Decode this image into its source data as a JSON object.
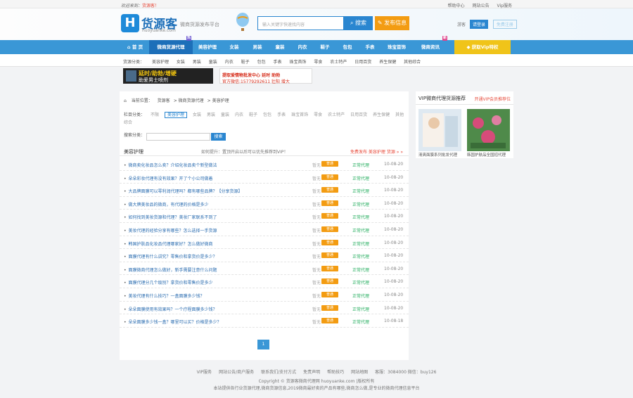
{
  "topbar": {
    "welcome": "欢迎来到：",
    "site": "货源客！",
    "links": [
      "帮助中心",
      "网站公告",
      "Vip服务"
    ]
  },
  "header": {
    "logo_mark": "H",
    "logo_text": "货源客",
    "logo_sub": "huoyuanke.com",
    "slogan": "微商货源发布平台",
    "search_placeholder": "输入关键字快速找内容",
    "search_btn": "搜索",
    "publish_btn": "发布信息",
    "login_hint": "游客",
    "login_btn": "请登录",
    "register_btn": "免费注册"
  },
  "nav": [
    {
      "label": "首 页"
    },
    {
      "label": "微商货源代理",
      "active": true,
      "badge": "热"
    },
    {
      "label": "美容护理"
    },
    {
      "label": "女装"
    },
    {
      "label": "男装"
    },
    {
      "label": "童装"
    },
    {
      "label": "内衣"
    },
    {
      "label": "鞋子"
    },
    {
      "label": "包包"
    },
    {
      "label": "手表"
    },
    {
      "label": "珠宝首饰"
    },
    {
      "label": "微商资讯",
      "badge": "新"
    },
    {
      "label": "获取Vip特权",
      "vip": true
    }
  ],
  "subnav": {
    "label": "货源分类：",
    "items": [
      "美容护理",
      "女装",
      "男装",
      "童装",
      "内衣",
      "鞋子",
      "包包",
      "手表",
      "珠宝首饰",
      "零食",
      "农土特产",
      "日用百货",
      "养生保健",
      "其他综合"
    ]
  },
  "banner1": {
    "a": "延时/助勃/增硬",
    "b": "助爱男士喷剂"
  },
  "banner2": {
    "a": "提取爱情物批发中心 延时 助勃",
    "b": "官方微信:15779292611 壮阳 增大"
  },
  "crumb": [
    "当前位置：",
    "货源客",
    "微商货源代理",
    "美容护理"
  ],
  "filter": {
    "label": "栏目分类：",
    "items": [
      "不限",
      "美容护理",
      "女装",
      "男装",
      "童装",
      "内衣",
      "鞋子",
      "包包",
      "手表",
      "珠宝首饰",
      "零食",
      "农土特产",
      "日用百货",
      "养生保健",
      "其他综合"
    ],
    "selected": 1
  },
  "search": {
    "label": "搜索分类：",
    "btn": "搜索"
  },
  "list": {
    "title": "美容护理",
    "notice": "如何提升：置顶开启以后可以优先推荐到VIP！",
    "action": "免费发布 美容护理 货源 » »"
  },
  "rows": [
    {
      "title": "微商卖化妆品怎么卖？介绍化妆品卖个新型做法",
      "mk": "暂无",
      "tag": "普通",
      "status": "正常代理",
      "date": "10-08-20"
    },
    {
      "title": "朵朵彩妆代理有没有效果？开了个小公司做着",
      "mk": "暂无",
      "tag": "普通",
      "status": "正常代理",
      "date": "10-08-20"
    },
    {
      "title": "大品牌面膜可以零利润代理吗？都有哪些品牌？【分享货源】",
      "mk": "暂无",
      "tag": "普通",
      "status": "正常代理",
      "date": "10-08-20"
    },
    {
      "title": "做大牌美妆品的微商，有代理的价格是多少",
      "mk": "暂无",
      "tag": "普通",
      "status": "正常代理",
      "date": "10-08-20"
    },
    {
      "title": "如何找到美妆货源和代理？美妆厂家联系不到了",
      "mk": "暂无",
      "tag": "普通",
      "status": "正常代理",
      "date": "10-08-20"
    },
    {
      "title": "美妆代理的经验分享有哪些？怎么选择一手货源",
      "mk": "暂无",
      "tag": "普通",
      "status": "正常代理",
      "date": "10-08-20"
    },
    {
      "title": "韩国护肤品化妆品代理哪家好？怎么做好微商",
      "mk": "暂无",
      "tag": "普通",
      "status": "正常代理",
      "date": "10-08-20"
    },
    {
      "title": "面膜代理有什么讲究？零售价和拿货价是多少？",
      "mk": "暂无",
      "tag": "普通",
      "status": "正常代理",
      "date": "10-08-20"
    },
    {
      "title": "面膜微商代理怎么做好，新手需要注意什么问题",
      "mk": "暂无",
      "tag": "普通",
      "status": "正常代理",
      "date": "10-08-20"
    },
    {
      "title": "面膜代理分几个级别？拿货价和零售价是多少",
      "mk": "暂无",
      "tag": "普通",
      "status": "正常代理",
      "date": "10-08-20"
    },
    {
      "title": "美妆代理有什么技巧？一盒面膜多少钱？",
      "mk": "暂无",
      "tag": "普通",
      "status": "正常代理",
      "date": "10-08-20"
    },
    {
      "title": "朵朵面膜使用有效果吗？一个疗程面膜多少钱？",
      "mk": "暂无",
      "tag": "普通",
      "status": "正常代理",
      "date": "10-08-20"
    },
    {
      "title": "朵朵面膜多少钱一盒？哪里可以买？价格是多少？",
      "mk": "暂无",
      "tag": "普通",
      "status": "正常代理",
      "date": "10-08-18"
    }
  ],
  "pager": "1",
  "side": {
    "title": "VIP微商代理货源推荐",
    "more": "开通VIP会员推荐位",
    "caps": [
      "清爽面膜系列批发代理",
      "韩国护肤品全国招代理"
    ]
  },
  "footer": {
    "links": [
      "VIP服务",
      "网站公告/商户服务",
      "联系我们/支付方式",
      "免责声明",
      "帮助技巧",
      "网站地图",
      "客服：3084000 微信：buy126"
    ],
    "copy": "Copyright © 货源客微商代理网 huoyuanke.com |版权所有",
    "desc": "本站提供各行业货源代理,微商货源信息,2019微商最好卖的产品有哪些,微商怎么做,是专业的微商代理信息平台"
  }
}
